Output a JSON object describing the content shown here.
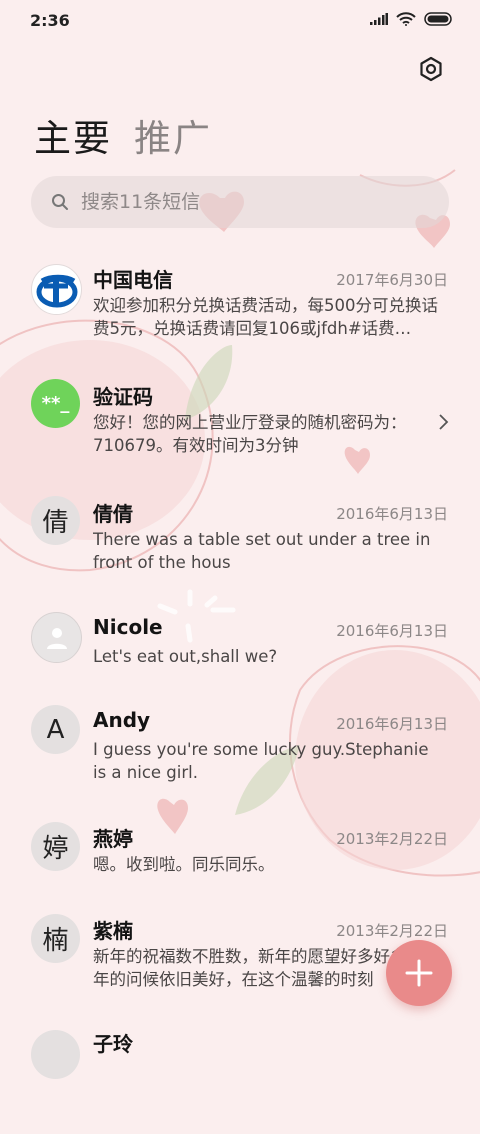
{
  "status_bar": {
    "time": "2:36"
  },
  "tabs": [
    {
      "label": "主要"
    },
    {
      "label": "推广"
    }
  ],
  "search": {
    "placeholder": "搜索11条短信"
  },
  "conversations": [
    {
      "name": "中国电信",
      "date": "2017年6月30日",
      "preview": "欢迎参加积分兑换话费活动，每500分可兑换话费5元，兑换话费请回复106或jfdh#话费…",
      "avatar": "china-telecom-logo"
    },
    {
      "name": "验证码",
      "date": "",
      "preview": "您好！您的网上营业厅登录的随机密码为：710679。有效时间为3分钟",
      "avatar": "verification-code-icon",
      "avatar_text": "**_"
    },
    {
      "name": "倩倩",
      "date": "2016年6月13日",
      "preview": "There was a table set out under a tree in front of the hous",
      "avatar_letter": "倩"
    },
    {
      "name": "Nicole",
      "date": "2016年6月13日",
      "preview": "Let's eat out,shall we?",
      "avatar": "person-icon"
    },
    {
      "name": "Andy",
      "date": "2016年6月13日",
      "preview": "I guess you're some lucky guy.Stephanie is a nice girl.",
      "avatar_letter": "A"
    },
    {
      "name": "燕婷",
      "date": "2013年2月22日",
      "preview": "嗯。收到啦。同乐同乐。",
      "avatar_letter": "婷"
    },
    {
      "name": "紫楠",
      "date": "2013年2月22日",
      "preview": "新年的祝福数不胜数，新年的愿望好多好多，新年的问候依旧美好，在这个温馨的时刻",
      "avatar_letter": "楠"
    },
    {
      "name": "子玲",
      "date": "",
      "preview": "",
      "avatar_letter": ""
    }
  ],
  "colors": {
    "background": "#fbeeee",
    "fab": "#e98a8a",
    "verify_avatar": "#6fd35a",
    "telecom_blue": "#0a5cb3"
  }
}
